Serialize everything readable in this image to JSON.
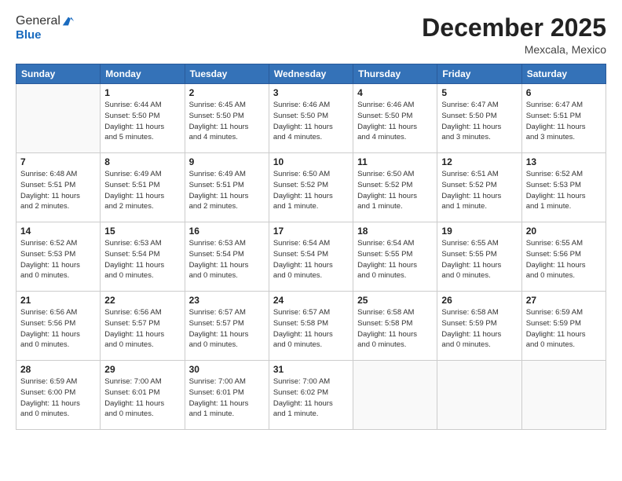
{
  "header": {
    "logo_line1": "General",
    "logo_line2": "Blue",
    "month": "December 2025",
    "location": "Mexcala, Mexico"
  },
  "weekdays": [
    "Sunday",
    "Monday",
    "Tuesday",
    "Wednesday",
    "Thursday",
    "Friday",
    "Saturday"
  ],
  "weeks": [
    [
      {
        "day": "",
        "info": ""
      },
      {
        "day": "1",
        "info": "Sunrise: 6:44 AM\nSunset: 5:50 PM\nDaylight: 11 hours\nand 5 minutes."
      },
      {
        "day": "2",
        "info": "Sunrise: 6:45 AM\nSunset: 5:50 PM\nDaylight: 11 hours\nand 4 minutes."
      },
      {
        "day": "3",
        "info": "Sunrise: 6:46 AM\nSunset: 5:50 PM\nDaylight: 11 hours\nand 4 minutes."
      },
      {
        "day": "4",
        "info": "Sunrise: 6:46 AM\nSunset: 5:50 PM\nDaylight: 11 hours\nand 4 minutes."
      },
      {
        "day": "5",
        "info": "Sunrise: 6:47 AM\nSunset: 5:50 PM\nDaylight: 11 hours\nand 3 minutes."
      },
      {
        "day": "6",
        "info": "Sunrise: 6:47 AM\nSunset: 5:51 PM\nDaylight: 11 hours\nand 3 minutes."
      }
    ],
    [
      {
        "day": "7",
        "info": "Sunrise: 6:48 AM\nSunset: 5:51 PM\nDaylight: 11 hours\nand 2 minutes."
      },
      {
        "day": "8",
        "info": "Sunrise: 6:49 AM\nSunset: 5:51 PM\nDaylight: 11 hours\nand 2 minutes."
      },
      {
        "day": "9",
        "info": "Sunrise: 6:49 AM\nSunset: 5:51 PM\nDaylight: 11 hours\nand 2 minutes."
      },
      {
        "day": "10",
        "info": "Sunrise: 6:50 AM\nSunset: 5:52 PM\nDaylight: 11 hours\nand 1 minute."
      },
      {
        "day": "11",
        "info": "Sunrise: 6:50 AM\nSunset: 5:52 PM\nDaylight: 11 hours\nand 1 minute."
      },
      {
        "day": "12",
        "info": "Sunrise: 6:51 AM\nSunset: 5:52 PM\nDaylight: 11 hours\nand 1 minute."
      },
      {
        "day": "13",
        "info": "Sunrise: 6:52 AM\nSunset: 5:53 PM\nDaylight: 11 hours\nand 1 minute."
      }
    ],
    [
      {
        "day": "14",
        "info": "Sunrise: 6:52 AM\nSunset: 5:53 PM\nDaylight: 11 hours\nand 0 minutes."
      },
      {
        "day": "15",
        "info": "Sunrise: 6:53 AM\nSunset: 5:54 PM\nDaylight: 11 hours\nand 0 minutes."
      },
      {
        "day": "16",
        "info": "Sunrise: 6:53 AM\nSunset: 5:54 PM\nDaylight: 11 hours\nand 0 minutes."
      },
      {
        "day": "17",
        "info": "Sunrise: 6:54 AM\nSunset: 5:54 PM\nDaylight: 11 hours\nand 0 minutes."
      },
      {
        "day": "18",
        "info": "Sunrise: 6:54 AM\nSunset: 5:55 PM\nDaylight: 11 hours\nand 0 minutes."
      },
      {
        "day": "19",
        "info": "Sunrise: 6:55 AM\nSunset: 5:55 PM\nDaylight: 11 hours\nand 0 minutes."
      },
      {
        "day": "20",
        "info": "Sunrise: 6:55 AM\nSunset: 5:56 PM\nDaylight: 11 hours\nand 0 minutes."
      }
    ],
    [
      {
        "day": "21",
        "info": "Sunrise: 6:56 AM\nSunset: 5:56 PM\nDaylight: 11 hours\nand 0 minutes."
      },
      {
        "day": "22",
        "info": "Sunrise: 6:56 AM\nSunset: 5:57 PM\nDaylight: 11 hours\nand 0 minutes."
      },
      {
        "day": "23",
        "info": "Sunrise: 6:57 AM\nSunset: 5:57 PM\nDaylight: 11 hours\nand 0 minutes."
      },
      {
        "day": "24",
        "info": "Sunrise: 6:57 AM\nSunset: 5:58 PM\nDaylight: 11 hours\nand 0 minutes."
      },
      {
        "day": "25",
        "info": "Sunrise: 6:58 AM\nSunset: 5:58 PM\nDaylight: 11 hours\nand 0 minutes."
      },
      {
        "day": "26",
        "info": "Sunrise: 6:58 AM\nSunset: 5:59 PM\nDaylight: 11 hours\nand 0 minutes."
      },
      {
        "day": "27",
        "info": "Sunrise: 6:59 AM\nSunset: 5:59 PM\nDaylight: 11 hours\nand 0 minutes."
      }
    ],
    [
      {
        "day": "28",
        "info": "Sunrise: 6:59 AM\nSunset: 6:00 PM\nDaylight: 11 hours\nand 0 minutes."
      },
      {
        "day": "29",
        "info": "Sunrise: 7:00 AM\nSunset: 6:01 PM\nDaylight: 11 hours\nand 0 minutes."
      },
      {
        "day": "30",
        "info": "Sunrise: 7:00 AM\nSunset: 6:01 PM\nDaylight: 11 hours\nand 1 minute."
      },
      {
        "day": "31",
        "info": "Sunrise: 7:00 AM\nSunset: 6:02 PM\nDaylight: 11 hours\nand 1 minute."
      },
      {
        "day": "",
        "info": ""
      },
      {
        "day": "",
        "info": ""
      },
      {
        "day": "",
        "info": ""
      }
    ]
  ]
}
